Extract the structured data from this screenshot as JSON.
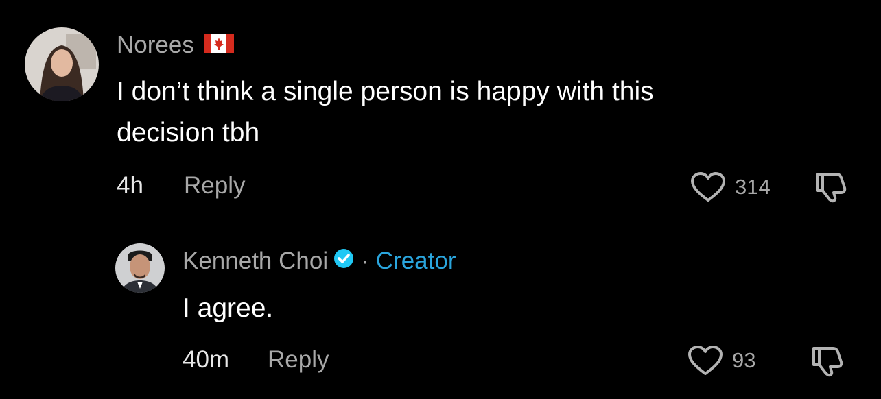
{
  "comments": [
    {
      "author": "Norees",
      "flag_icon": "canada-flag-icon",
      "text_lines": [
        "I don’t think a single person is happy with this",
        "decision tbh"
      ],
      "time": "4h",
      "reply_label": "Reply",
      "likes": "314"
    }
  ],
  "reply": {
    "author": "Kenneth Choi",
    "verified_icon": "verified-badge-icon",
    "separator": "·",
    "creator_label": "Creator",
    "text": "I agree.",
    "time": "40m",
    "reply_label": "Reply",
    "likes": "93"
  },
  "colors": {
    "background": "#000000",
    "name": "#a8a8a8",
    "text": "#ffffff",
    "creator": "#2aa5dd",
    "verified": "#20c8f4",
    "flag_red": "#d52b1e"
  }
}
